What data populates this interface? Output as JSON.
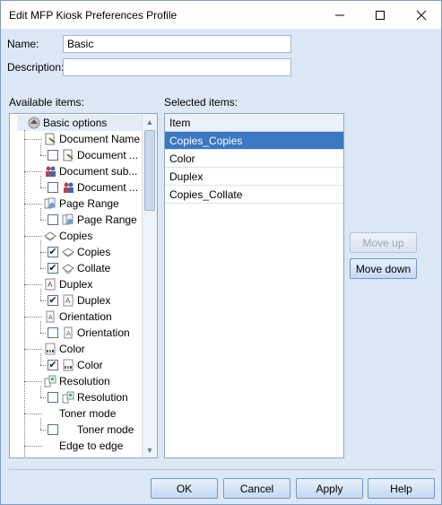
{
  "window": {
    "title": "Edit MFP Kiosk Preferences Profile",
    "controls": [
      "minimize",
      "maximize",
      "close"
    ]
  },
  "form": {
    "name_label": "Name:",
    "name_value": "Basic",
    "description_label": "Description:",
    "description_value": ""
  },
  "available": {
    "label": "Available items:",
    "tree": [
      {
        "label": "Basic options",
        "level": 0,
        "checkbox": null,
        "icon": "up-arrow-icon"
      },
      {
        "label": "Document Name",
        "level": 1,
        "checkbox": null,
        "icon": "document-name-icon"
      },
      {
        "label": "Document ...",
        "level": 2,
        "checkbox": false,
        "icon": "document-name-icon"
      },
      {
        "label": "Document sub...",
        "level": 1,
        "checkbox": null,
        "icon": "users-icon"
      },
      {
        "label": "Document ...",
        "level": 2,
        "checkbox": false,
        "icon": "users-icon"
      },
      {
        "label": "Page Range",
        "level": 1,
        "checkbox": null,
        "icon": "page-range-icon"
      },
      {
        "label": "Page Range",
        "level": 2,
        "checkbox": false,
        "icon": "page-range-icon"
      },
      {
        "label": "Copies",
        "level": 1,
        "checkbox": null,
        "icon": "copies-icon"
      },
      {
        "label": "Copies",
        "level": 2,
        "checkbox": true,
        "icon": "copies-icon"
      },
      {
        "label": "Collate",
        "level": 2,
        "checkbox": true,
        "icon": "collate-icon"
      },
      {
        "label": "Duplex",
        "level": 1,
        "checkbox": null,
        "icon": "duplex-icon"
      },
      {
        "label": "Duplex",
        "level": 2,
        "checkbox": true,
        "icon": "duplex-icon"
      },
      {
        "label": "Orientation",
        "level": 1,
        "checkbox": null,
        "icon": "orientation-icon"
      },
      {
        "label": "Orientation",
        "level": 2,
        "checkbox": false,
        "icon": "orientation-icon"
      },
      {
        "label": "Color",
        "level": 1,
        "checkbox": null,
        "icon": "color-icon"
      },
      {
        "label": "Color",
        "level": 2,
        "checkbox": true,
        "icon": "color-icon"
      },
      {
        "label": "Resolution",
        "level": 1,
        "checkbox": null,
        "icon": "resolution-icon"
      },
      {
        "label": "Resolution",
        "level": 2,
        "checkbox": false,
        "icon": "resolution-icon"
      },
      {
        "label": "Toner mode",
        "level": 1,
        "checkbox": null,
        "icon": "none"
      },
      {
        "label": "Toner mode",
        "level": 2,
        "checkbox": false,
        "icon": "none"
      },
      {
        "label": "Edge to edge",
        "level": 1,
        "checkbox": null,
        "icon": "none"
      }
    ]
  },
  "selected": {
    "label": "Selected items:",
    "column_header": "Item",
    "items": [
      "Copies_Copies",
      "Color",
      "Duplex",
      "Copies_Collate"
    ],
    "selected_index": 0
  },
  "side_buttons": {
    "move_up": "Move up",
    "move_down": "Move down"
  },
  "footer": {
    "ok": "OK",
    "cancel": "Cancel",
    "apply": "Apply",
    "help": "Help"
  },
  "colors": {
    "selection": "#3b77c3",
    "window_bg": "#dce8f5",
    "button_border": "#7097c9"
  }
}
